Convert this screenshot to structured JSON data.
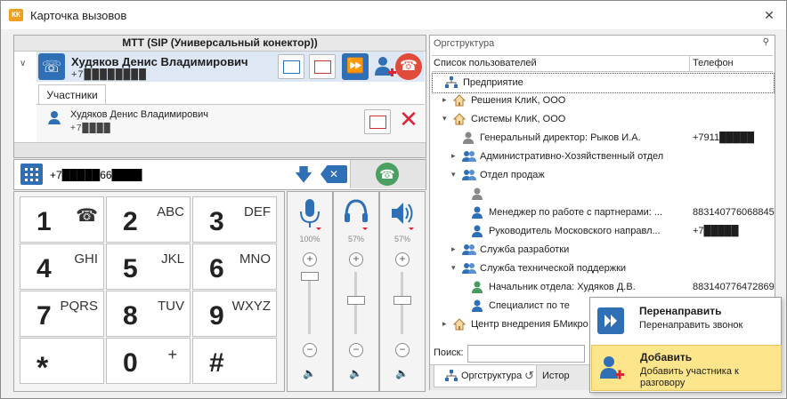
{
  "window": {
    "title": "Карточка вызовов",
    "close_label": "✕"
  },
  "call": {
    "header": "МТТ (SIP (Универсальный конектор))",
    "caller_name": "Худяков Денис Владимирович",
    "caller_number": "+7████████",
    "participants_tab": "Участники",
    "participant_name": "Худяков Денис Владимирович",
    "participant_number": "+7████"
  },
  "dial": {
    "number": "+7█████66████"
  },
  "keypad": [
    {
      "digit": "1",
      "letters": ""
    },
    {
      "digit": "2",
      "letters": "ABC"
    },
    {
      "digit": "3",
      "letters": "DEF"
    },
    {
      "digit": "4",
      "letters": "GHI"
    },
    {
      "digit": "5",
      "letters": "JKL"
    },
    {
      "digit": "6",
      "letters": "MNO"
    },
    {
      "digit": "7",
      "letters": "PQRS"
    },
    {
      "digit": "8",
      "letters": "TUV"
    },
    {
      "digit": "9",
      "letters": "WXYZ"
    },
    {
      "digit": "*",
      "letters": ""
    },
    {
      "digit": "0",
      "letters": "+"
    },
    {
      "digit": "#",
      "letters": ""
    }
  ],
  "volume": {
    "mic": {
      "pct": "100%",
      "level": 1.0
    },
    "headset": {
      "pct": "57%",
      "level": 0.57
    },
    "speaker": {
      "pct": "57%",
      "level": 0.57
    }
  },
  "org": {
    "title": "Оргструктура",
    "col_users": "Список пользователей",
    "col_phone": "Телефон",
    "rows": [
      {
        "text": "Предприятие",
        "phone": "",
        "icon": "tree-root-icon",
        "expander": ""
      },
      {
        "text": "Решения КлиК, ООО",
        "phone": "",
        "icon": "house-icon",
        "expander": "▸"
      },
      {
        "text": "Системы КлиК, ООО",
        "phone": "",
        "icon": "house-icon",
        "expander": "▾"
      },
      {
        "text": "Генеральный директор: Рыков И.А.",
        "phone": "+7911█████",
        "icon": "person-icon",
        "expander": ""
      },
      {
        "text": "Административно-Хозяйственный отдел",
        "phone": "",
        "icon": "group-icon",
        "expander": "▸"
      },
      {
        "text": "Отдел продаж",
        "phone": "",
        "icon": "group-icon",
        "expander": "▾"
      },
      {
        "text": "",
        "phone": "",
        "icon": "person-icon",
        "expander": ""
      },
      {
        "text": "Менеджер по работе с партнерами: ...",
        "phone": "883140776068845",
        "icon": "person-icon",
        "expander": ""
      },
      {
        "text": "Руководитель Московского направл...",
        "phone": "+7█████",
        "icon": "person-icon",
        "expander": ""
      },
      {
        "text": "Служба разработки",
        "phone": "",
        "icon": "group-icon",
        "expander": "▸"
      },
      {
        "text": "Служба технической поддержки",
        "phone": "",
        "icon": "group-icon",
        "expander": "▾"
      },
      {
        "text": "Начальник отдела: Худяков Д.В.",
        "phone": "883140776472869",
        "icon": "person-icon",
        "expander": ""
      },
      {
        "text": "Специалист по те",
        "phone": "",
        "icon": "person-icon",
        "expander": ""
      },
      {
        "text": "Центр внедрения БМикро",
        "phone": "",
        "icon": "house-icon",
        "expander": "▸"
      }
    ],
    "search_label": "Поиск:",
    "tab_org": "Оргструктура",
    "tab_history": "Истор"
  },
  "popup": {
    "redirect_title": "Перенаправить",
    "redirect_desc": "Перенаправить звонок",
    "add_title": "Добавить",
    "add_desc": "Добавить участника к разговору"
  },
  "colors": {
    "accent": "#2f6fb5",
    "hangup": "#e24a3a",
    "call": "#4aa060",
    "highlight": "#fce58a"
  }
}
